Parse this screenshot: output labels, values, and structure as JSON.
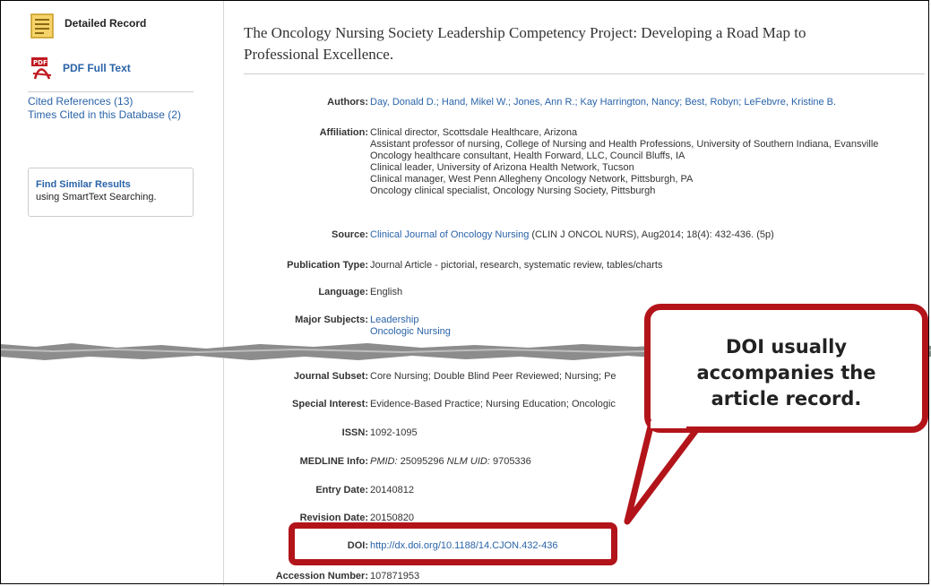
{
  "sidebar": {
    "detailed_record": "Detailed Record",
    "pdf_full_text": "PDF Full Text",
    "cited_references": "Cited References (13)",
    "times_cited": "Times Cited in this Database (2)",
    "find_similar_title": "Find Similar Results",
    "find_similar_sub": "using SmartText Searching."
  },
  "record": {
    "title_line1": "The Oncology Nursing Society Leadership Competency Project: Developing a Road Map to",
    "title_line2": "Professional Excellence.",
    "authors_label": "Authors:",
    "authors": "Day, Donald D.; Hand, Mikel W.; Jones, Ann R.; Kay Harrington, Nancy; Best, Robyn; LeFebvre, Kristine B.",
    "affiliation_label": "Affiliation:",
    "affiliation": [
      "Clinical director, Scottsdale Healthcare, Arizona",
      "Assistant professor of nursing, College of Nursing and Health Professions, University of Southern Indiana, Evansville",
      "Oncology healthcare consultant, Health Forward, LLC, Council Bluffs, IA",
      "Clinical leader, University of Arizona Health Network, Tucson",
      "Clinical manager, West Penn Allegheny Oncology Network, Pittsburgh, PA",
      "Oncology clinical specialist, Oncology Nursing Society, Pittsburgh"
    ],
    "source_label": "Source:",
    "source_journal": "Clinical Journal of Oncology Nursing",
    "source_rest": " (CLIN J ONCOL NURS), Aug2014; 18(4): 432-436. (5p)",
    "pubtype_label": "Publication Type:",
    "pubtype": "Journal Article - pictorial, research, systematic review, tables/charts",
    "language_label": "Language:",
    "language": "English",
    "major_label": "Major Subjects:",
    "major": [
      "Leadership",
      "Oncologic Nursing"
    ],
    "subset_label": "Journal Subset:",
    "subset": "Core Nursing; Double Blind Peer Reviewed; Nursing; Pe",
    "special_label": "Special Interest:",
    "special": "Evidence-Based Practice; Nursing Education; Oncologic",
    "issn_label": "ISSN:",
    "issn": "1092-1095",
    "medline_label": "MEDLINE Info:",
    "medline_pmid": "PMID:",
    "medline_pmid_val": " 25095296 ",
    "medline_nlm": "NLM UID:",
    "medline_nlm_val": " 9705336",
    "entry_label": "Entry Date:",
    "entry": "20140812",
    "revision_label": "Revision Date:",
    "revision": "20150820",
    "doi_label": "DOI:",
    "doi": "http://dx.doi.org/10.1188/14.CJON.432-436",
    "accession_label": "Accession Number:",
    "accession": "107871953"
  },
  "callout": {
    "line1": "DOI usually",
    "line2": "accompanies the",
    "line3": "article record.",
    "color": "#b2141a"
  }
}
